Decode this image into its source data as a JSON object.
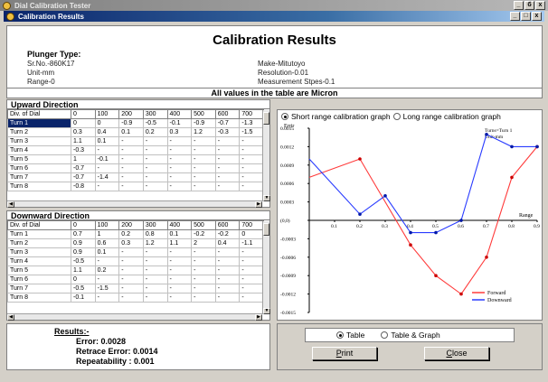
{
  "window": {
    "outer_title": "Dial Calibration Tester",
    "inner_title": "Calibration Results",
    "outer_controls": [
      "_",
      "б",
      "x"
    ],
    "inner_controls": [
      "_",
      "□",
      "x"
    ]
  },
  "header": {
    "title": "Calibration Results",
    "plunger_label": "Plunger Type:",
    "left_info": [
      "Sr.No.-860K17",
      "Unit-mm",
      "Range-0"
    ],
    "right_info": [
      "Make-Mitutoyo",
      "Resolution-0.01",
      "Measurement Stpes-0.1"
    ],
    "micron_note": "All values in the table are Micron"
  },
  "upward": {
    "title": "Upward Direction",
    "columns": [
      "Div. of Dial",
      "0",
      "100",
      "200",
      "300",
      "400",
      "500",
      "600",
      "700"
    ],
    "rows": [
      [
        "Turn 1",
        "0",
        "0",
        "-0.9",
        "-0.5",
        "-0.1",
        "-0.9",
        "-0.7",
        "-1.3"
      ],
      [
        "Turn 2",
        "0.3",
        "0.4",
        "0.1",
        "0.2",
        "0.3",
        "1.2",
        "-0.3",
        "-1.5"
      ],
      [
        "Turn 3",
        "1.1",
        "0.1",
        "-",
        "-",
        "-",
        "-",
        "-",
        "-"
      ],
      [
        "Turn 4",
        "-0.3",
        "-",
        "-",
        "-",
        "-",
        "-",
        "-",
        "-"
      ],
      [
        "Turn 5",
        "1",
        "-0.1",
        "-",
        "-",
        "-",
        "-",
        "-",
        "-"
      ],
      [
        "Turn 6",
        "-0.7",
        "-",
        "-",
        "-",
        "-",
        "-",
        "-",
        "-"
      ],
      [
        "Turn 7",
        "-0.7",
        "-1.4",
        "-",
        "-",
        "-",
        "-",
        "-",
        "-"
      ],
      [
        "Turn 8",
        "-0.8",
        "-",
        "-",
        "-",
        "-",
        "-",
        "-",
        "-"
      ]
    ]
  },
  "downward": {
    "title": "Downward Direction",
    "columns": [
      "Div. of Dial",
      "0",
      "100",
      "200",
      "300",
      "400",
      "500",
      "600",
      "700"
    ],
    "rows": [
      [
        "Turn 1",
        "0.7",
        "1",
        "0.2",
        "0.8",
        "0.1",
        "-0.2",
        "-0.2",
        "0"
      ],
      [
        "Turn 2",
        "0.9",
        "0.6",
        "0.3",
        "1.2",
        "1.1",
        "2",
        "0.4",
        "-1.1"
      ],
      [
        "Turn 3",
        "0.9",
        "0.1",
        "-",
        "-",
        "-",
        "-",
        "-",
        "-"
      ],
      [
        "Turn 4",
        "-0.5",
        "-",
        "-",
        "-",
        "-",
        "-",
        "-",
        "-"
      ],
      [
        "Turn 5",
        "1.1",
        "0.2",
        "-",
        "-",
        "-",
        "-",
        "-",
        "-"
      ],
      [
        "Turn 6",
        "0",
        "-",
        "-",
        "-",
        "-",
        "-",
        "-",
        "-"
      ],
      [
        "Turn 7",
        "-0.5",
        "-1.5",
        "-",
        "-",
        "-",
        "-",
        "-",
        "-"
      ],
      [
        "Turn 8",
        "-0.1",
        "-",
        "-",
        "-",
        "-",
        "-",
        "-",
        "-"
      ]
    ]
  },
  "results": {
    "title": "Results:-",
    "error": "Error: 0.0028",
    "retrace": "Retrace Error: 0.0014",
    "repeatability": "Repeatability  : 0.001"
  },
  "graph_options": {
    "short": "Short range calibration graph",
    "long": "Long range calibration graph",
    "selected": "short"
  },
  "chart_data": {
    "type": "line",
    "ylabel": "Errir",
    "xlabel": "Range",
    "annotation": [
      "Turns=Turn 1",
      "Unit-mm"
    ],
    "ylim": [
      -0.0015,
      0.0015
    ],
    "xlim": [
      0,
      0.9
    ],
    "x_ticks": [
      "0.1",
      "0.2",
      "0.3",
      "0.4",
      "0.5",
      "0.6",
      "0.7",
      "0.8",
      "0.9"
    ],
    "y_ticks": [
      "0.0015",
      "0.0012",
      "0.0009",
      "0.0006",
      "0.0003",
      "(0,0)",
      "-0.0003",
      "-0.0006",
      "-0.0009",
      "-0.0012",
      "-0.0015"
    ],
    "series": [
      {
        "name": "Forward",
        "color": "#ff3b3b",
        "marker": "#cc0000",
        "x": [
          0,
          0.2,
          0.4,
          0.5,
          0.6,
          0.7,
          0.8,
          0.9
        ],
        "y": [
          0.0007,
          0.001,
          -0.0004,
          -0.0009,
          -0.0012,
          -0.0006,
          0.0007,
          0.0012
        ]
      },
      {
        "name": "Downward",
        "color": "#2a3cff",
        "marker": "#0018a8",
        "x": [
          0,
          0.2,
          0.3,
          0.4,
          0.5,
          0.6,
          0.7,
          0.8,
          0.9
        ],
        "y": [
          0.001,
          0.0001,
          0.0004,
          -0.0002,
          -0.0002,
          0,
          0.0014,
          0.0012,
          0.0012
        ]
      }
    ],
    "legend": "bottom-right"
  },
  "view": {
    "table": "Table",
    "table_graph": "Table & Graph",
    "selected": "table"
  },
  "buttons": {
    "print_u": "P",
    "print_rest": "rint",
    "close_u": "C",
    "close_rest": "lose"
  }
}
